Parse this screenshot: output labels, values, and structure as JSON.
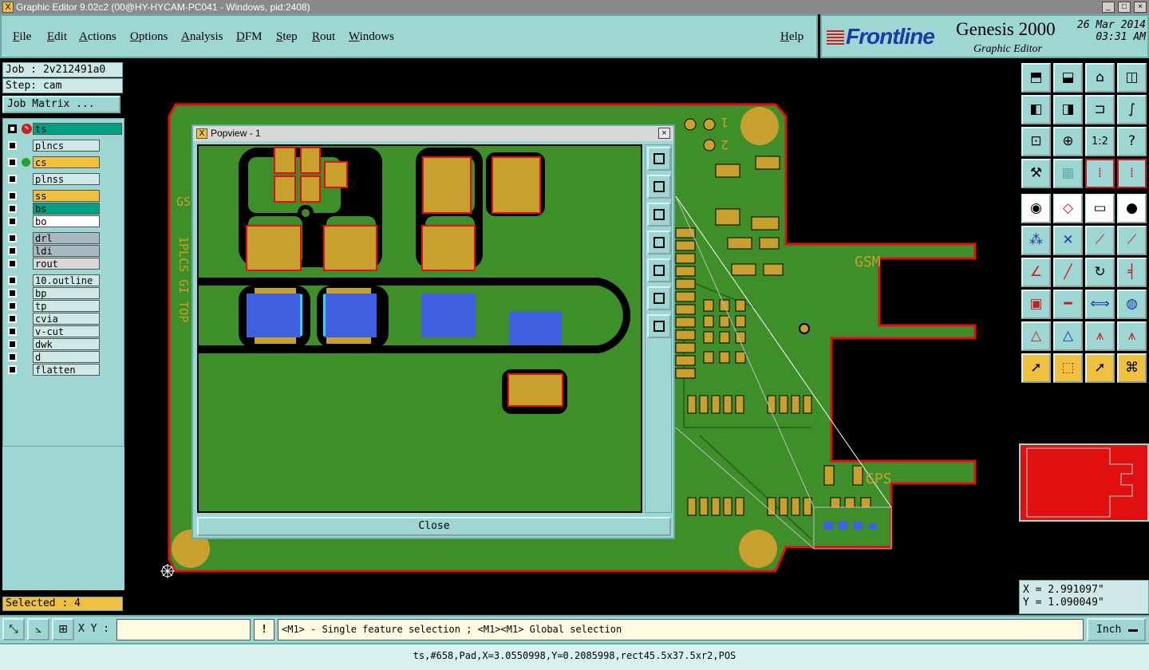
{
  "window": {
    "title": "Graphic Editor 9.02c2 (00@HY-HYCAM-PC041 - Windows, pid:2408)"
  },
  "menu": {
    "items": [
      "File",
      "Edit",
      "Actions",
      "Options",
      "Analysis",
      "DFM",
      "Step",
      "Rout",
      "Windows"
    ],
    "help": "Help"
  },
  "brand": {
    "logo": "Frontline",
    "product": "Genesis 2000",
    "subtitle": "Graphic Editor",
    "date": "26 Mar 2014",
    "time": "03:31 AM"
  },
  "job": {
    "job_label": "Job : 2v212491a0",
    "step_label": "Step: cam",
    "matrix_button": "Job Matrix ..."
  },
  "layers": [
    {
      "name": "ts",
      "color": "#00a080",
      "state": "work"
    },
    {
      "name": "plncs",
      "color": "#cfe9e8",
      "state": "off"
    },
    {
      "name": "cs",
      "color": "#f0c040",
      "state": "display"
    },
    {
      "name": "plnss",
      "color": "#cfe9e8",
      "state": "off"
    },
    {
      "name": "ss",
      "color": "#f0c040",
      "state": "off"
    },
    {
      "name": "bs",
      "color": "#00a080",
      "state": "off"
    },
    {
      "name": "bo",
      "color": "#ffffff",
      "state": "off"
    },
    {
      "name": "drl",
      "color": "#a8b8c0",
      "state": "off"
    },
    {
      "name": "ldi",
      "color": "#a8b8c0",
      "state": "off"
    },
    {
      "name": "rout",
      "color": "#d8d8d8",
      "state": "off"
    },
    {
      "name": "10.outline",
      "color": "#cfe9e8",
      "state": "off"
    },
    {
      "name": "bp",
      "color": "#cfe9e8",
      "state": "off"
    },
    {
      "name": "tp",
      "color": "#cfe9e8",
      "state": "off"
    },
    {
      "name": "cvia",
      "color": "#cfe9e8",
      "state": "off"
    },
    {
      "name": "v-cut",
      "color": "#cfe9e8",
      "state": "off"
    },
    {
      "name": "dwk",
      "color": "#cfe9e8",
      "state": "off"
    },
    {
      "name": "d",
      "color": "#cfe9e8",
      "state": "off"
    },
    {
      "name": "flatten",
      "color": "#cfe9e8",
      "state": "off"
    }
  ],
  "selection": {
    "label": "Selected : 4"
  },
  "board": {
    "labels": [
      "GSM",
      "GPS",
      "1",
      "2",
      "GS",
      "1PLCS GI TOP"
    ]
  },
  "popview": {
    "title": "Popview - 1",
    "close_label": "Close",
    "close_x": "×"
  },
  "coords": {
    "x": "X = 2.991097\"",
    "y": "Y = 1.090049\""
  },
  "input": {
    "xy_label": "X Y :",
    "xy_value": "",
    "excl": "!",
    "prompt": "<M1> - Single feature selection ; <M1><M1> Global selection",
    "units": "Inch"
  },
  "status": {
    "text": "ts,#658,Pad,X=3.0550998,Y=0.2085998,rect45.5x37.5xr2,POS"
  },
  "colors": {
    "board_green": "#3e8e2a",
    "pad_gold": "#c8a030",
    "outline_red": "#e01010",
    "ui_cyan": "#9ed6d4",
    "selected_blue": "#4060e0"
  }
}
